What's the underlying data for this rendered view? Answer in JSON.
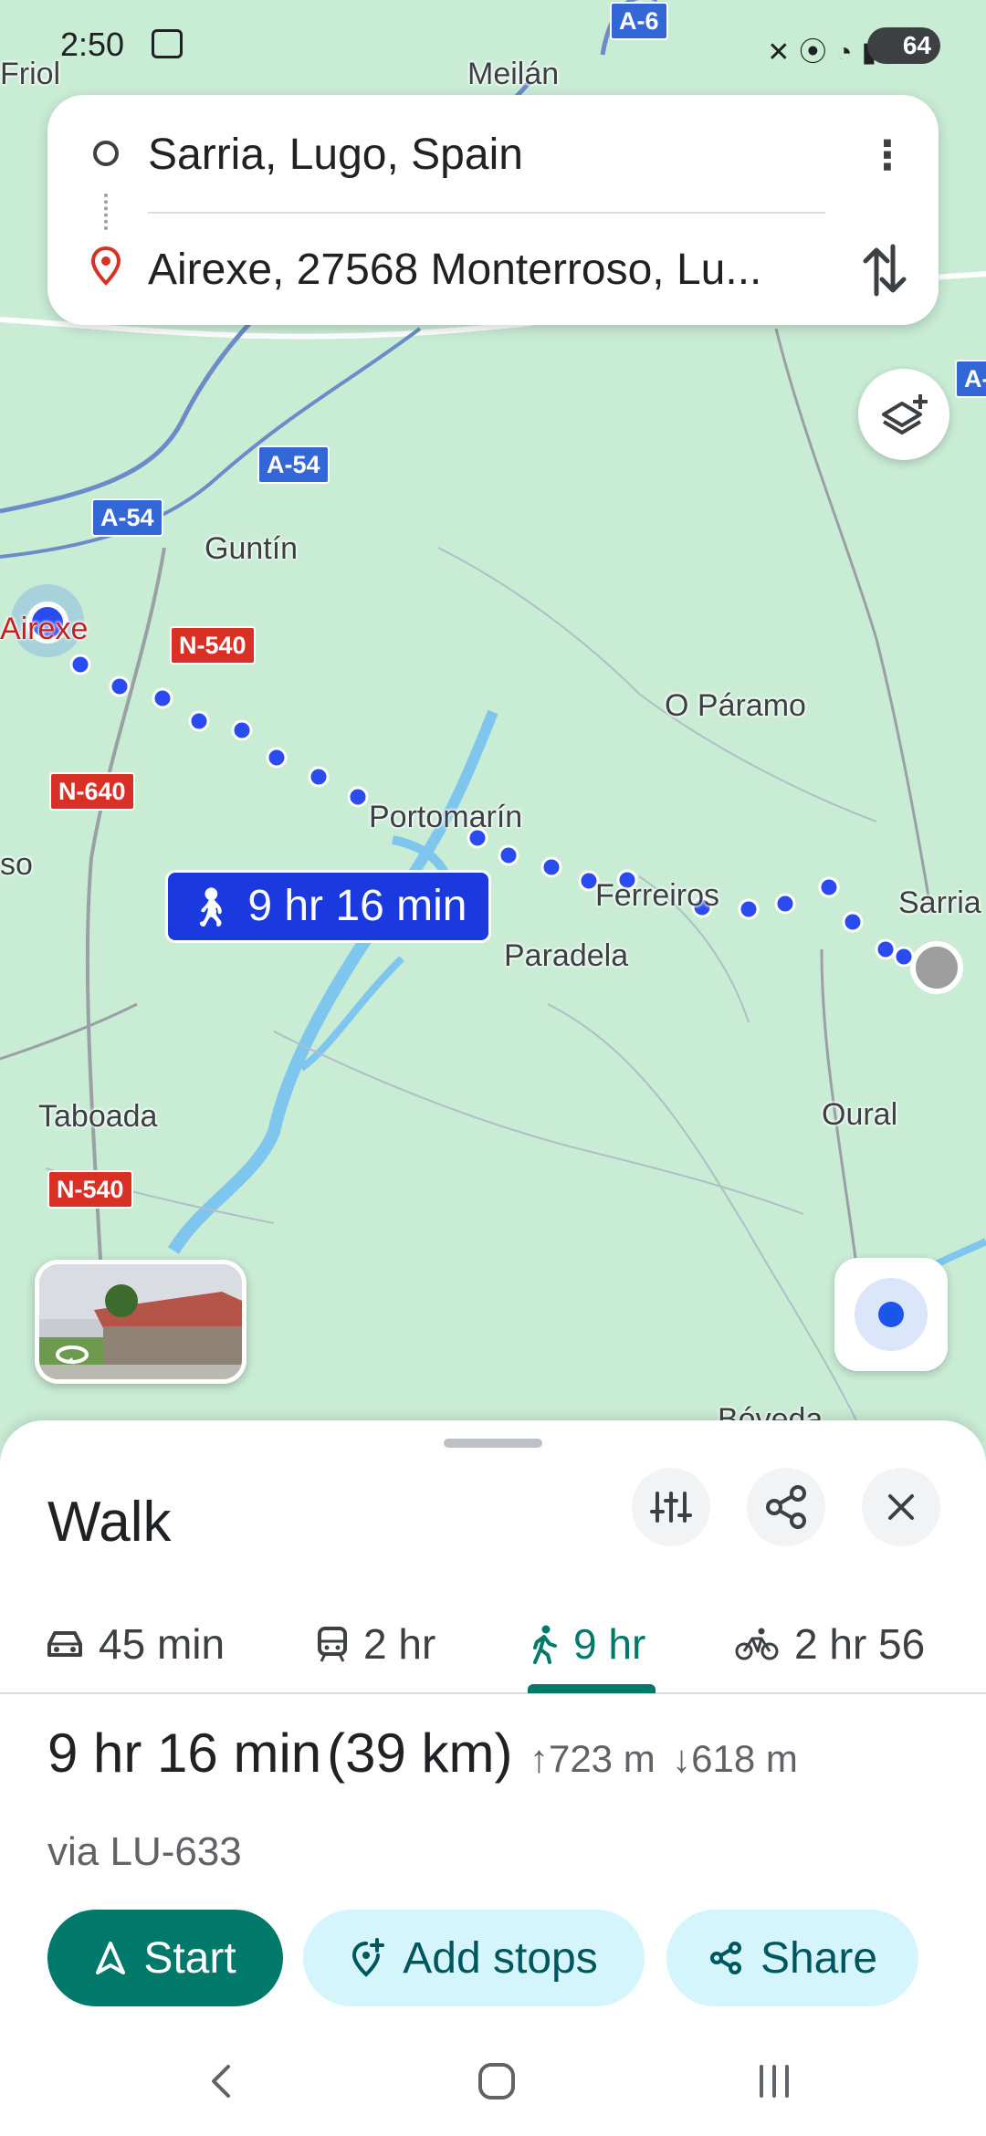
{
  "status_bar": {
    "time": "2:50",
    "battery": "64",
    "icons": [
      "mute-icon",
      "location-icon",
      "wifi-icon",
      "signal-icon"
    ]
  },
  "search": {
    "origin": "Sarria, Lugo, Spain",
    "destination": "Airexe, 27568 Monterroso, Lu..."
  },
  "map": {
    "places": {
      "friol": "Friol",
      "meilan": "Meilán",
      "guntin": "Guntín",
      "airexe": "Airexe",
      "o_paramo": "O Páramo",
      "portomarin": "Portomarín",
      "ferreiros": "Ferreiros",
      "sarria": "Sarria",
      "paradela": "Paradela",
      "taboada": "Taboada",
      "oural": "Oural",
      "so": "so",
      "boveda": "Bóveda"
    },
    "shields": {
      "a6": "A-6",
      "a54_a": "A-54",
      "a54_b": "A-54",
      "a_right": "A-",
      "n540_a": "N-540",
      "n640": "N-640",
      "n540_b": "N-540"
    },
    "eta_label": "9 hr 16 min",
    "colors": {
      "route": "#1a3ae0",
      "water": "#7fc6ef",
      "land": "#c9ecd5"
    }
  },
  "sheet": {
    "title": "Walk",
    "modes": [
      {
        "label": "45 min",
        "icon": "car-icon"
      },
      {
        "label": "2 hr",
        "icon": "train-icon"
      },
      {
        "label": "9 hr",
        "icon": "walk-icon",
        "active": true
      },
      {
        "label": "2 hr 56",
        "icon": "bike-icon"
      }
    ],
    "duration": "9 hr 16 min",
    "distance": "(39 km)",
    "ascent": "723 m",
    "descent": "618 m",
    "via": "via LU-633",
    "actions": {
      "start": "Start",
      "add_stops": "Add stops",
      "share": "Share"
    },
    "accent": "#00796b"
  }
}
